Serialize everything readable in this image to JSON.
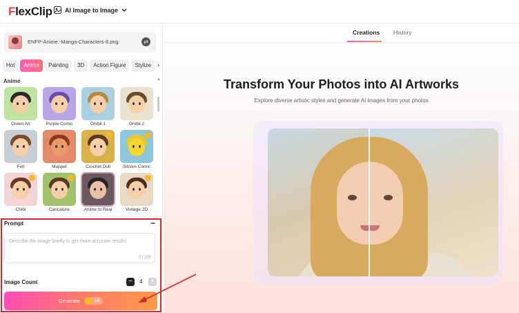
{
  "app": {
    "logo": "FlexClip",
    "tool_switch_label": "AI Image to Image"
  },
  "file": {
    "name": "ENFP-Anime.-Manga-Characters-8.png"
  },
  "style_tabs": [
    "Hot",
    "Anime",
    "Painting",
    "3D",
    "Action Figure",
    "Stylize"
  ],
  "active_tab": "Anime",
  "section_title": "Anime",
  "styles": [
    {
      "label": "Green Art",
      "premium": false
    },
    {
      "label": "Purple Comic",
      "premium": false
    },
    {
      "label": "Ghibli 1",
      "premium": false
    },
    {
      "label": "Ghibli 2",
      "premium": false
    },
    {
      "label": "Felt",
      "premium": false
    },
    {
      "label": "Muppet",
      "premium": false
    },
    {
      "label": "Crochet Doll",
      "premium": true
    },
    {
      "label": "Sitcom Comic",
      "premium": true
    },
    {
      "label": "Chibi",
      "premium": true
    },
    {
      "label": "Caricature",
      "premium": true
    },
    {
      "label": "Anime to Real",
      "premium": false,
      "selected": true
    },
    {
      "label": "Vintage 2D",
      "premium": true
    }
  ],
  "prompt": {
    "title": "Prompt",
    "placeholder": "Describe the image briefly to get more accurate results",
    "counter": "0 / 200"
  },
  "image_count": {
    "label": "Image Count",
    "value": "4"
  },
  "generate": {
    "label": "Generate",
    "credits": "-16"
  },
  "right_tabs": {
    "creations": "Creations",
    "history": "History"
  },
  "hero": {
    "title": "Transform Your Photos into AI Artworks",
    "subtitle": "Explore diverse artistic styles and generate AI images from your photos"
  },
  "colors": {
    "accent_pink": "#ff5fb5",
    "accent_orange": "#ff8a5c",
    "annotation_red": "#d9262c"
  }
}
